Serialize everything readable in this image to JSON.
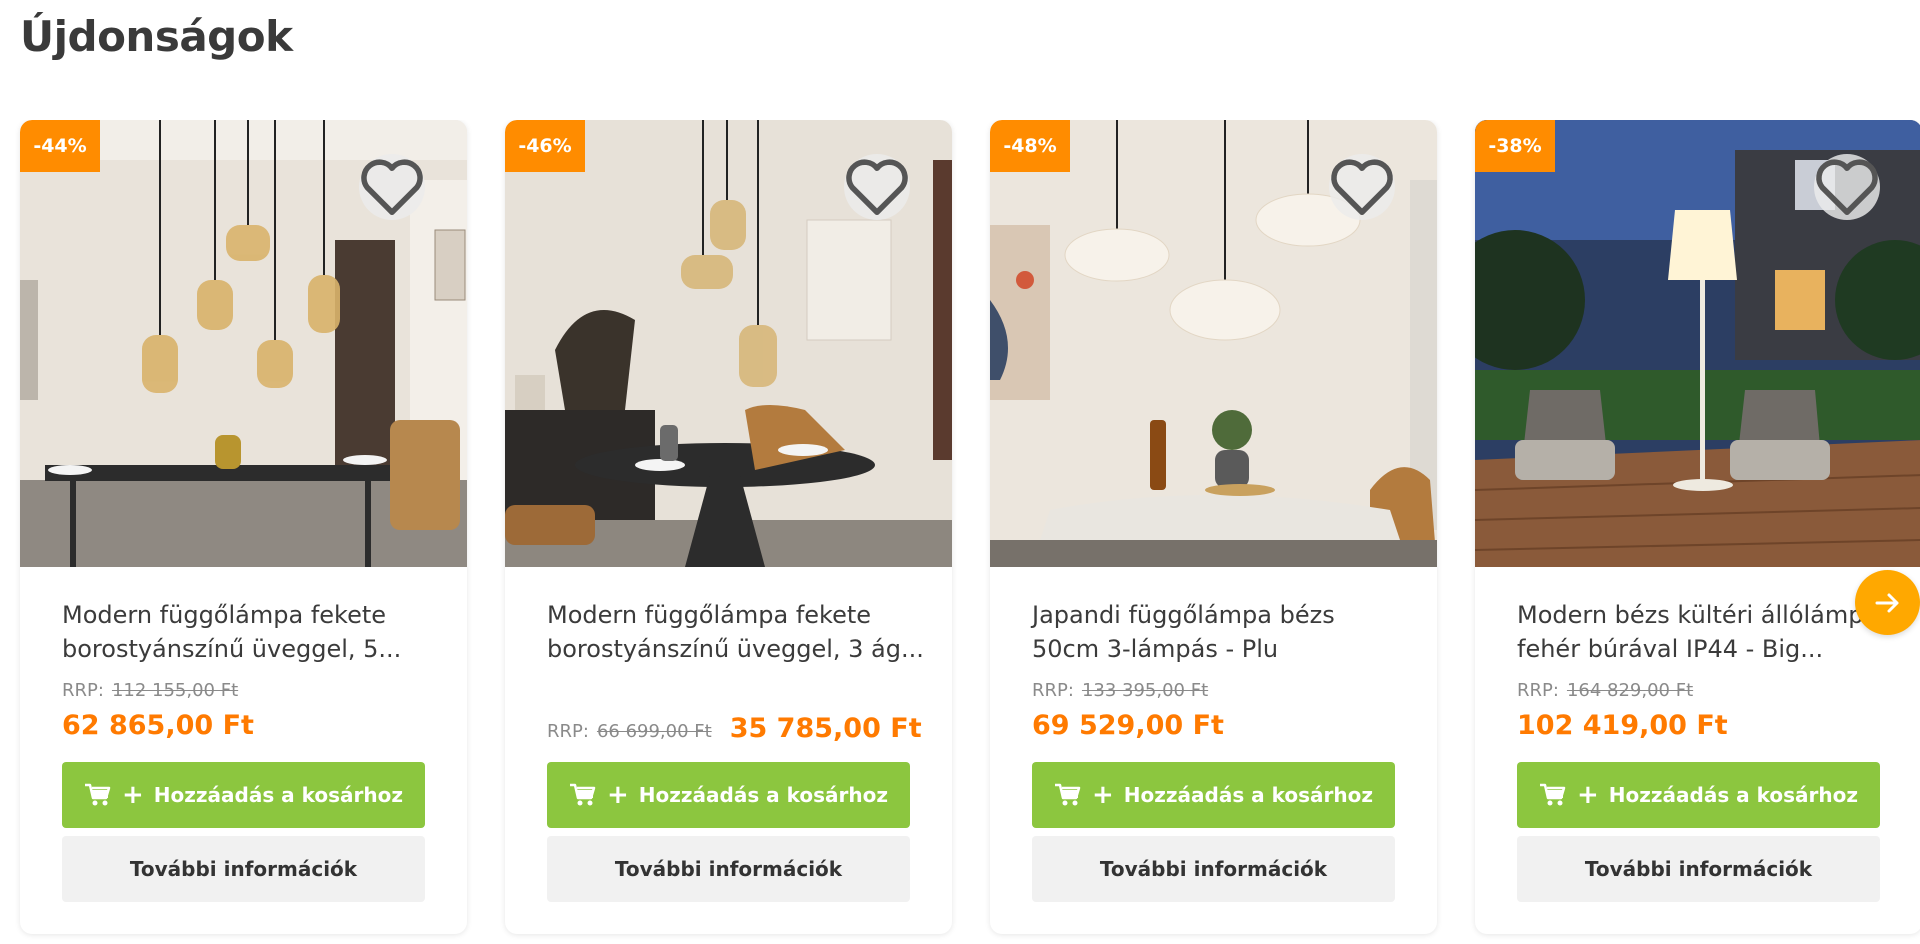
{
  "section": {
    "title": "Újdonságok"
  },
  "colors": {
    "accent_orange": "#ff7a00",
    "badge_orange": "#ff8c00",
    "cart_green": "#8cc63f",
    "arrow_yellow": "#ffa800"
  },
  "icons": {
    "wishlist": "heart-icon",
    "cart": "cart-icon",
    "next": "arrow-right-icon"
  },
  "products": [
    {
      "discount": "-44%",
      "name": "Modern függőlámpa fekete\nborostyánszínű üveggel, 5...",
      "rrp_label": "RRP:",
      "rrp_price": "112 155,00 Ft",
      "price": "62 865,00 Ft",
      "add_to_cart": "Hozzáadás a kosárhoz",
      "more_info": "További információk"
    },
    {
      "discount": "-46%",
      "name": "Modern függőlámpa fekete\nborostyánszínű üveggel, 3 ág...",
      "rrp_label": "RRP:",
      "rrp_price": "66 699,00 Ft",
      "price": "35 785,00 Ft",
      "add_to_cart": "Hozzáadás a kosárhoz",
      "more_info": "További információk"
    },
    {
      "discount": "-48%",
      "name": "Japandi függőlámpa bézs\n50cm 3-lámpás - Plu",
      "rrp_label": "RRP:",
      "rrp_price": "133 395,00 Ft",
      "price": "69 529,00 Ft",
      "add_to_cart": "Hozzáadás a kosárhoz",
      "more_info": "További információk"
    },
    {
      "discount": "-38%",
      "name": "Modern bézs kültéri állólámpa\nfehér búrával IP44 - Big...",
      "rrp_label": "RRP:",
      "rrp_price": "164 829,00 Ft",
      "price": "102 419,00 Ft",
      "add_to_cart": "Hozzáadás a kosárhoz",
      "more_info": "További információk"
    }
  ]
}
